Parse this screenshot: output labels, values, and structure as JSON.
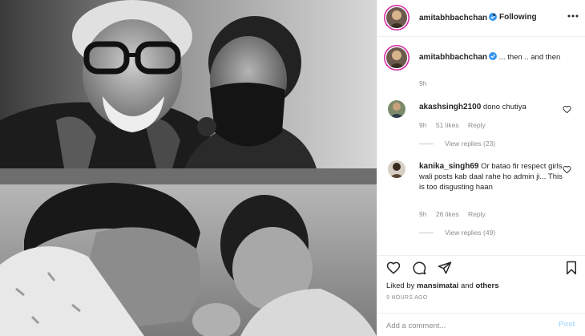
{
  "post": {
    "author": "amitabhbachchan",
    "follow_state": "Following",
    "separator": "•",
    "more_icon": "more-horizontal-icon",
    "verified_icon": "verified-badge-icon"
  },
  "caption": {
    "username": "amitabhbachchan",
    "text": "... then .. and then",
    "time": "9h"
  },
  "comments": [
    {
      "username": "akashsingh2100",
      "text": "dono chutiya",
      "time": "9h",
      "likes": "51 likes",
      "reply_label": "Reply",
      "view_replies": "View replies (23)"
    },
    {
      "username": "kanika_singh69",
      "text": "Or batao fir respect girls wali posts kab daal rahe ho admin ji... This is too disgusting haan",
      "time": "9h",
      "likes": "26 likes",
      "reply_label": "Reply",
      "view_replies": "View replies (49)"
    }
  ],
  "actions": {
    "liked_prefix": "Liked by",
    "liked_user": "mansimatai",
    "liked_and": "and",
    "liked_others": "others",
    "timestamp": "9 HOURS AGO",
    "comment_placeholder": "Add a comment...",
    "post_label": "Post"
  },
  "colors": {
    "verified": "#3897f0",
    "text": "#262626",
    "muted": "#8e8e8e",
    "border": "#efefef",
    "post_disabled": "#b2dffc",
    "story_ring": "#d6249f"
  }
}
